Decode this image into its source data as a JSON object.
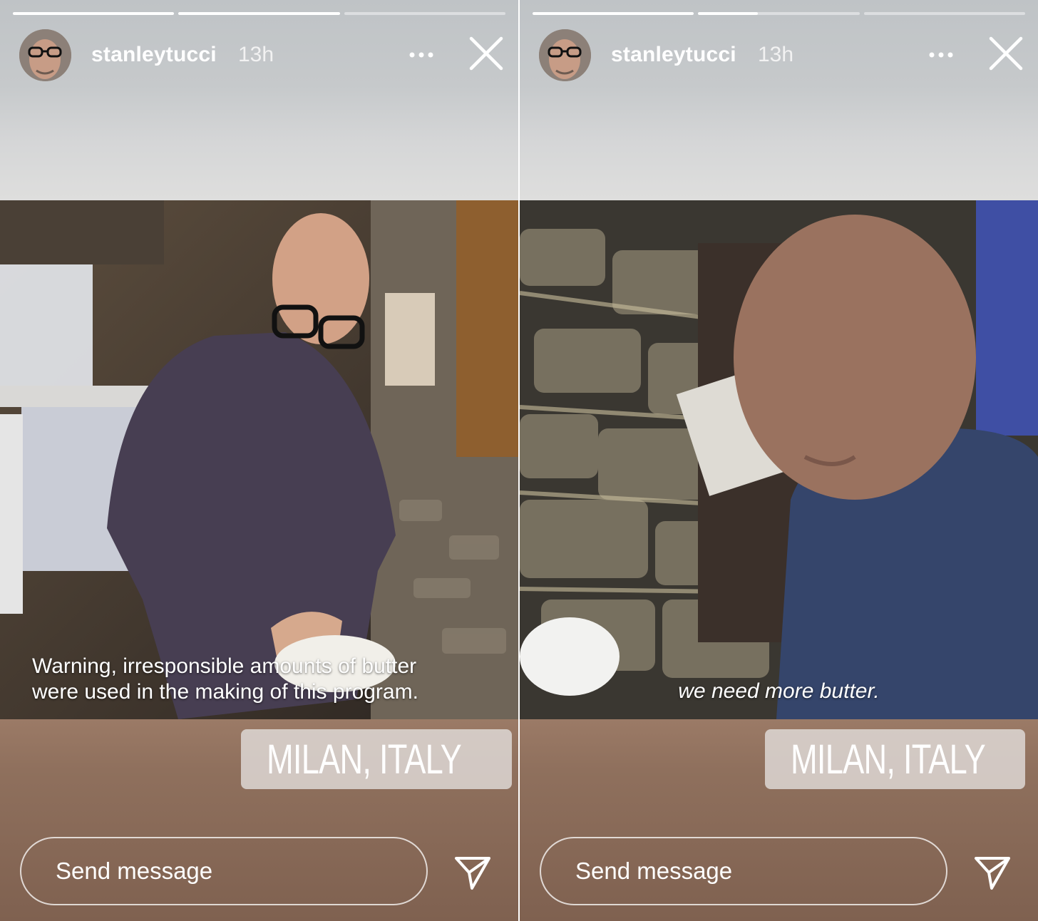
{
  "stories": [
    {
      "id": "left",
      "progress": [
        1.0,
        1.0,
        0.0
      ],
      "username": "stanleytucci",
      "timestamp": "13h",
      "caption": [
        "Warning, irresponsible amounts of butter",
        "were used in the making of this program."
      ],
      "location": "MILAN, ITALY",
      "message_placeholder": "Send message"
    },
    {
      "id": "right",
      "progress": [
        1.0,
        0.37,
        0.0
      ],
      "username": "stanleytucci",
      "timestamp": "13h",
      "caption": [
        "we need more butter."
      ],
      "location": "MILAN, ITALY",
      "message_placeholder": "Send message"
    }
  ],
  "icons": {
    "more": "more-horizontal-icon",
    "close": "close-icon",
    "location": "location-pin-icon",
    "send": "send-icon"
  },
  "colors": {
    "text": "#ffffff",
    "location_sticker_bg": "#e1dcd9"
  }
}
